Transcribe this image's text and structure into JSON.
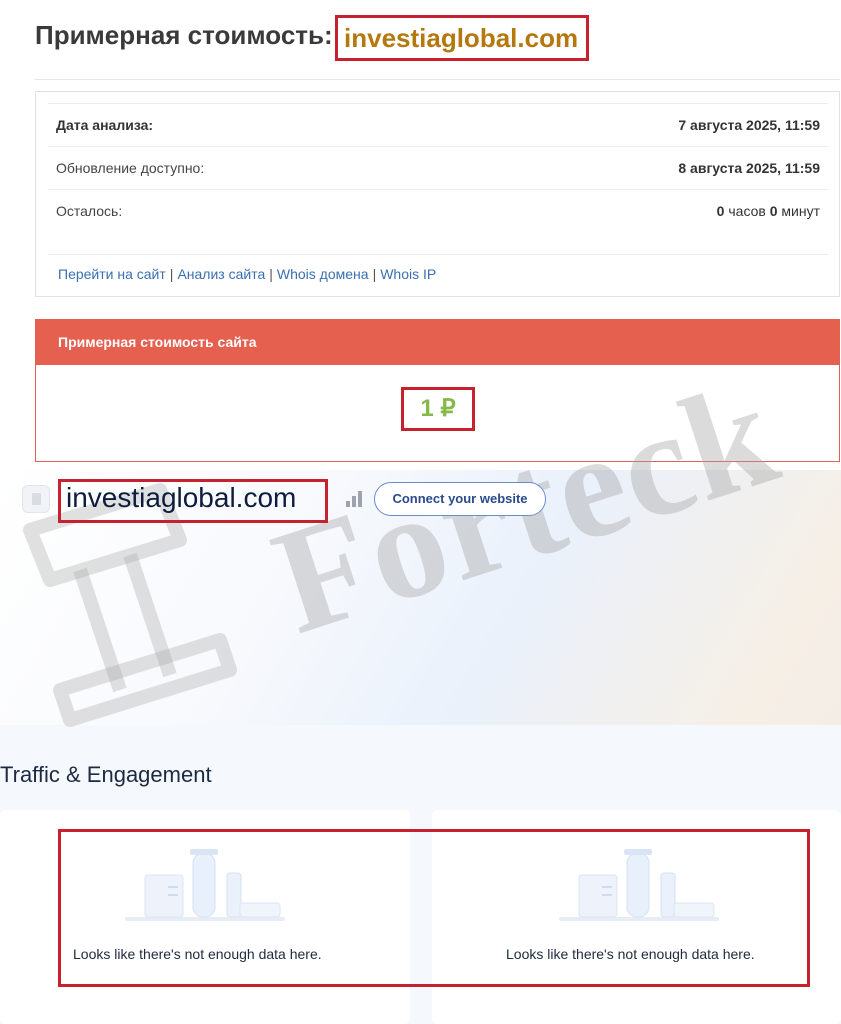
{
  "header": {
    "title_prefix": "Примерная стоимость:",
    "title_domain": "investiaglobal.com"
  },
  "info": {
    "rows": [
      {
        "label": "Дата анализа:",
        "value": "7 августа 2025, 11:59"
      },
      {
        "label": "Обновление доступно:",
        "value": "8 августа 2025, 11:59"
      }
    ],
    "remaining": {
      "label": "Осталось:",
      "hours": "0",
      "hours_unit": "часов",
      "minutes": "0",
      "minutes_unit": "минут"
    },
    "links": [
      "Перейти на сайт",
      "Анализ сайта",
      "Whois домена",
      "Whois IP"
    ],
    "separator": "|"
  },
  "value_card": {
    "header": "Примерная стоимость сайта",
    "value": "1 ₽"
  },
  "site": {
    "domain": "investiaglobal.com",
    "connect_label": "Connect your website"
  },
  "traffic": {
    "section_title": "Traffic & Engagement",
    "empty_left": "Looks like there's not enough data here.",
    "empty_right": "Looks like there's not enough data here."
  },
  "watermark": {
    "text": "Forteck"
  },
  "colors": {
    "accent_red": "#e5604f",
    "highlight_border": "#c7202e",
    "domain_gold": "#b5780f",
    "value_green": "#86b94a",
    "link_blue": "#3a6fb0"
  },
  "icons": [
    "favicon-icon",
    "rank-bars-icon",
    "empty-data-illustration-icon"
  ]
}
